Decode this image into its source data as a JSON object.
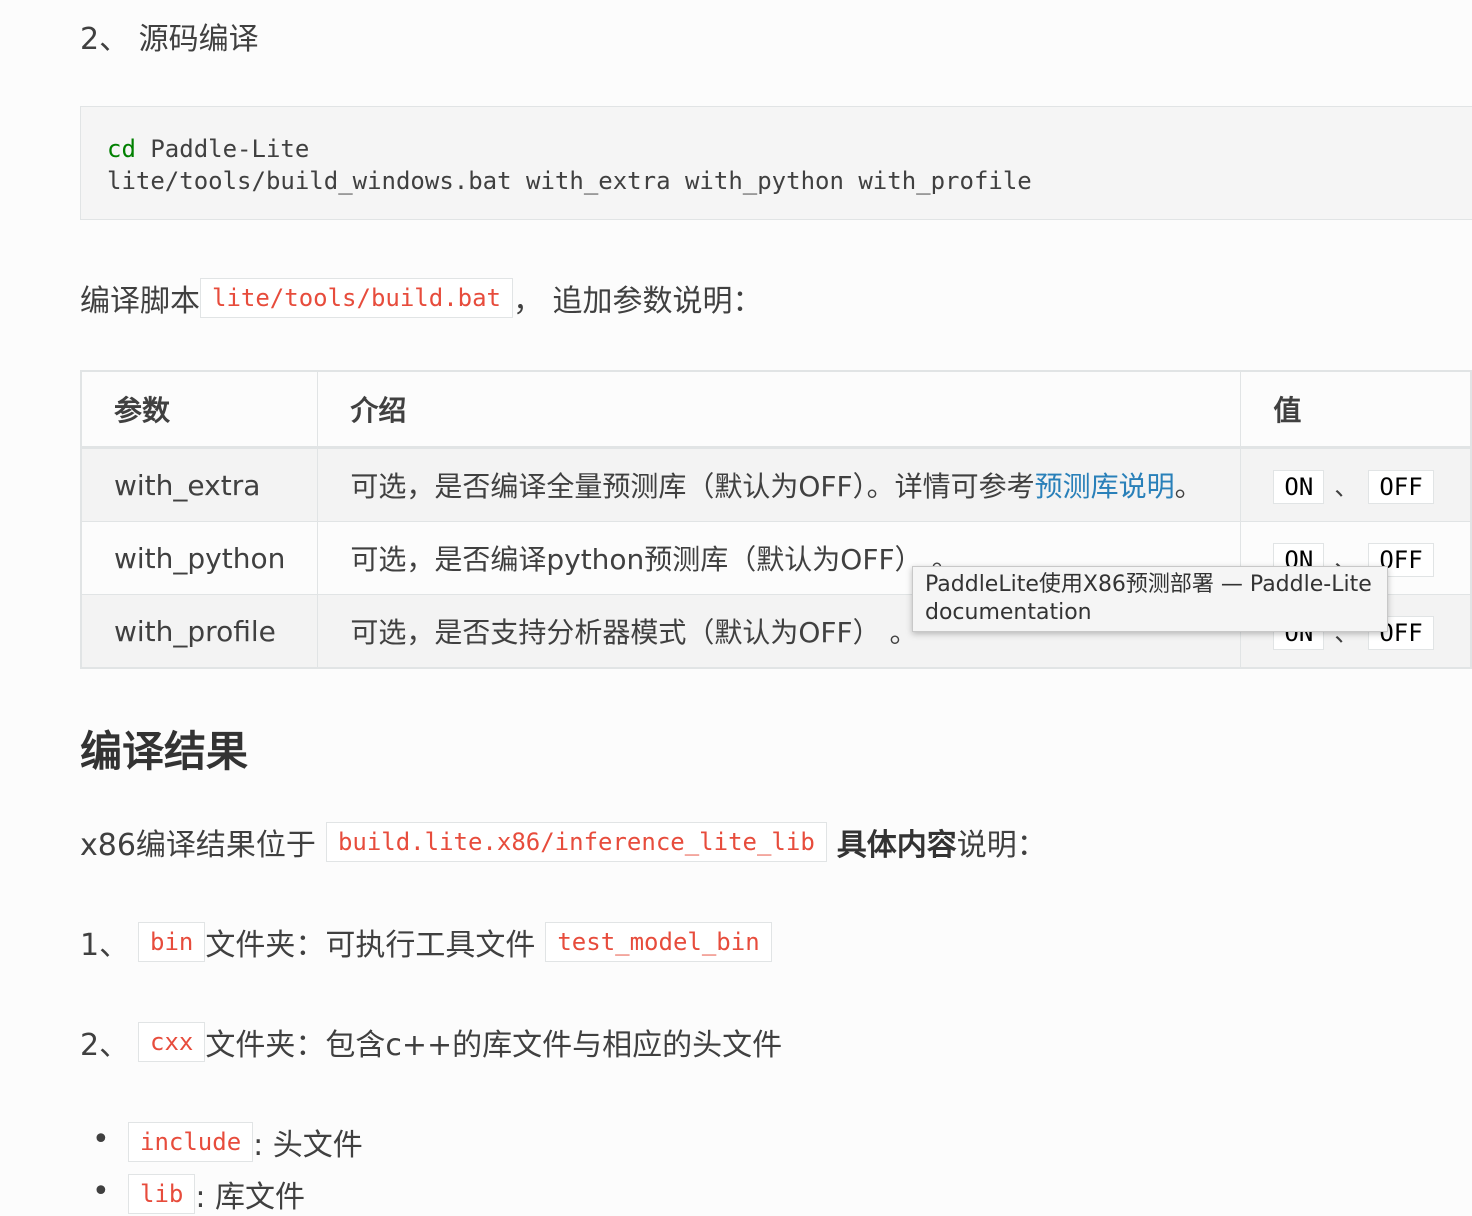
{
  "section": {
    "heading": "2、 源码编译"
  },
  "code": {
    "line1_cmd": "cd",
    "line1_arg": " Paddle-Lite",
    "line2": "lite/tools/build_windows.bat with_extra with_python with_profile"
  },
  "script_para": {
    "prefix": "编译脚本",
    "code": "lite/tools/build.bat",
    "suffix": "， 追加参数说明："
  },
  "table": {
    "headers": [
      "参数",
      "介绍",
      "值"
    ],
    "rows": [
      {
        "param": "with_extra",
        "desc": "可选，是否编译全量预测库（默认为OFF）。详情可参考",
        "link": "预测库说明",
        "desc_end": "。",
        "on": "ON",
        "sep": "、",
        "off": "OFF"
      },
      {
        "param": "with_python",
        "desc": "可选，是否编译python预测库（默认为OFF） 。",
        "on": "ON",
        "sep": "、",
        "off": "OFF"
      },
      {
        "param": "with_profile",
        "desc": "可选，是否支持分析器模式（默认为OFF） 。",
        "on": "ON",
        "sep": "、",
        "off": "OFF"
      }
    ]
  },
  "tooltip": {
    "line1": "PaddleLite使用X86预测部署 — Paddle-Lite",
    "line2": "documentation"
  },
  "results": {
    "heading": "编译结果",
    "intro_prefix": "x86编译结果位于",
    "intro_code": "build.lite.x86/inference_lite_lib",
    "intro_bold": "具体内容",
    "intro_suffix": "说明：",
    "item1_num": "1、",
    "item1_code": "bin",
    "item1_text": "文件夹：可执行工具文件",
    "item1_code2": "test_model_bin",
    "item2_num": "2、",
    "item2_code": "cxx",
    "item2_text": "文件夹：包含c++的库文件与相应的头文件",
    "bullets": [
      {
        "code": "include",
        "text": " : 头文件"
      },
      {
        "code": "lib",
        "text": " : 库文件"
      }
    ]
  }
}
